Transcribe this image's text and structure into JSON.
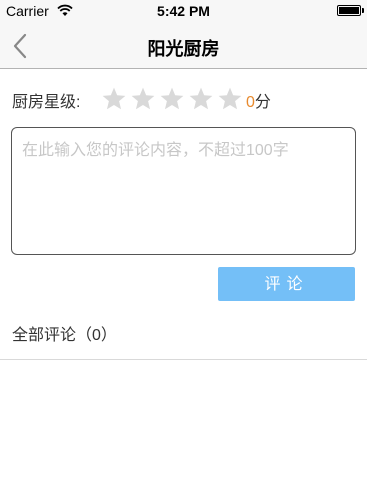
{
  "status_bar": {
    "carrier": "Carrier",
    "time": "5:42 PM",
    "icons": [
      "wifi-icon",
      "battery-icon"
    ]
  },
  "nav": {
    "title": "阳光厨房",
    "back_icon": "chevron-left-icon"
  },
  "rating": {
    "label": "厨房星级:",
    "stars_total": 5,
    "stars_filled": 0,
    "score": "0",
    "unit": "分",
    "star_color_empty": "#d9d9d9",
    "score_color": "#e88a2e"
  },
  "comment": {
    "placeholder": "在此输入您的评论内容，不超过100字",
    "value": ""
  },
  "submit": {
    "label": "评论",
    "color": "#74bff7"
  },
  "all_comments": {
    "label": "全部评论（0）"
  }
}
